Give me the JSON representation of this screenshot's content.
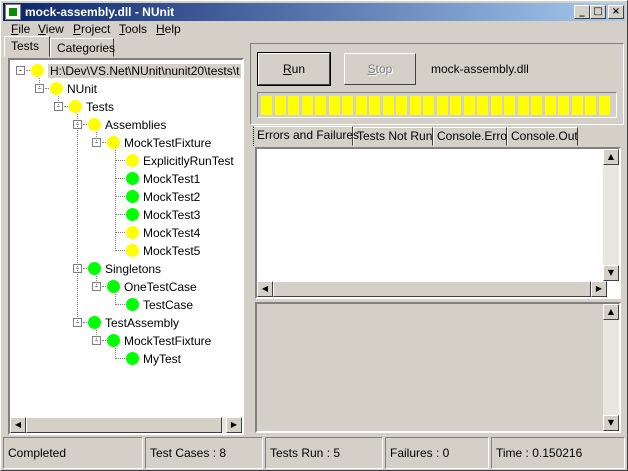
{
  "window": {
    "title": "mock-assembly.dll - NUnit",
    "minimize": "_",
    "maximize": "□",
    "close": "×"
  },
  "menu": [
    {
      "label": "File",
      "u": "F",
      "rest": "ile"
    },
    {
      "label": "View",
      "u": "V",
      "rest": "iew"
    },
    {
      "label": "Project",
      "u": "P",
      "rest": "roject"
    },
    {
      "label": "Tools",
      "u": "T",
      "rest": "ools"
    },
    {
      "label": "Help",
      "u": "H",
      "rest": "elp"
    }
  ],
  "left_tabs": [
    "Tests",
    "Categories"
  ],
  "tree": [
    {
      "label": "H:\\Dev\\VS.Net\\NUnit\\nunit20\\tests\\t",
      "status": "yellow",
      "level": 0,
      "expander": "-"
    },
    {
      "label": "NUnit",
      "status": "yellow",
      "level": 1,
      "expander": "-"
    },
    {
      "label": "Tests",
      "status": "yellow",
      "level": 2,
      "expander": "-"
    },
    {
      "label": "Assemblies",
      "status": "yellow",
      "level": 3,
      "expander": "-"
    },
    {
      "label": "MockTestFixture",
      "status": "yellow",
      "level": 4,
      "expander": "-"
    },
    {
      "label": "ExplicitlyRunTest",
      "status": "yellow",
      "level": 5,
      "expander": ""
    },
    {
      "label": "MockTest1",
      "status": "green",
      "level": 5,
      "expander": ""
    },
    {
      "label": "MockTest2",
      "status": "green",
      "level": 5,
      "expander": ""
    },
    {
      "label": "MockTest3",
      "status": "green",
      "level": 5,
      "expander": ""
    },
    {
      "label": "MockTest4",
      "status": "yellow",
      "level": 5,
      "expander": ""
    },
    {
      "label": "MockTest5",
      "status": "yellow",
      "level": 5,
      "expander": ""
    },
    {
      "label": "Singletons",
      "status": "green",
      "level": 3,
      "expander": "-"
    },
    {
      "label": "OneTestCase",
      "status": "green",
      "level": 4,
      "expander": "-"
    },
    {
      "label": "TestCase",
      "status": "green",
      "level": 5,
      "expander": ""
    },
    {
      "label": "TestAssembly",
      "status": "green",
      "level": 3,
      "expander": "-"
    },
    {
      "label": "MockTestFixture",
      "status": "green",
      "level": 4,
      "expander": "-"
    },
    {
      "label": "MyTest",
      "status": "green",
      "level": 5,
      "expander": ""
    }
  ],
  "colors": {
    "yellow": "#ffff00",
    "green": "#00ff00",
    "progress": "#ffff00"
  },
  "run_button": {
    "u": "R",
    "rest": "un"
  },
  "stop_button": {
    "u": "S",
    "rest": "top"
  },
  "assembly_name": "mock-assembly.dll",
  "progress": {
    "fraction": 1.0,
    "segments": 26
  },
  "result_tabs": [
    "Errors and Failures",
    "Tests Not Run",
    "Console.Error",
    "Console.Out"
  ],
  "status": {
    "state": "Completed",
    "test_cases": "Test Cases : 8",
    "tests_run": "Tests Run : 5",
    "failures": "Failures : 0",
    "time": "Time : 0.150216"
  },
  "icons": {
    "scroll_left": "◀",
    "scroll_right": "▶",
    "scroll_up": "▲",
    "scroll_down": "▼"
  }
}
